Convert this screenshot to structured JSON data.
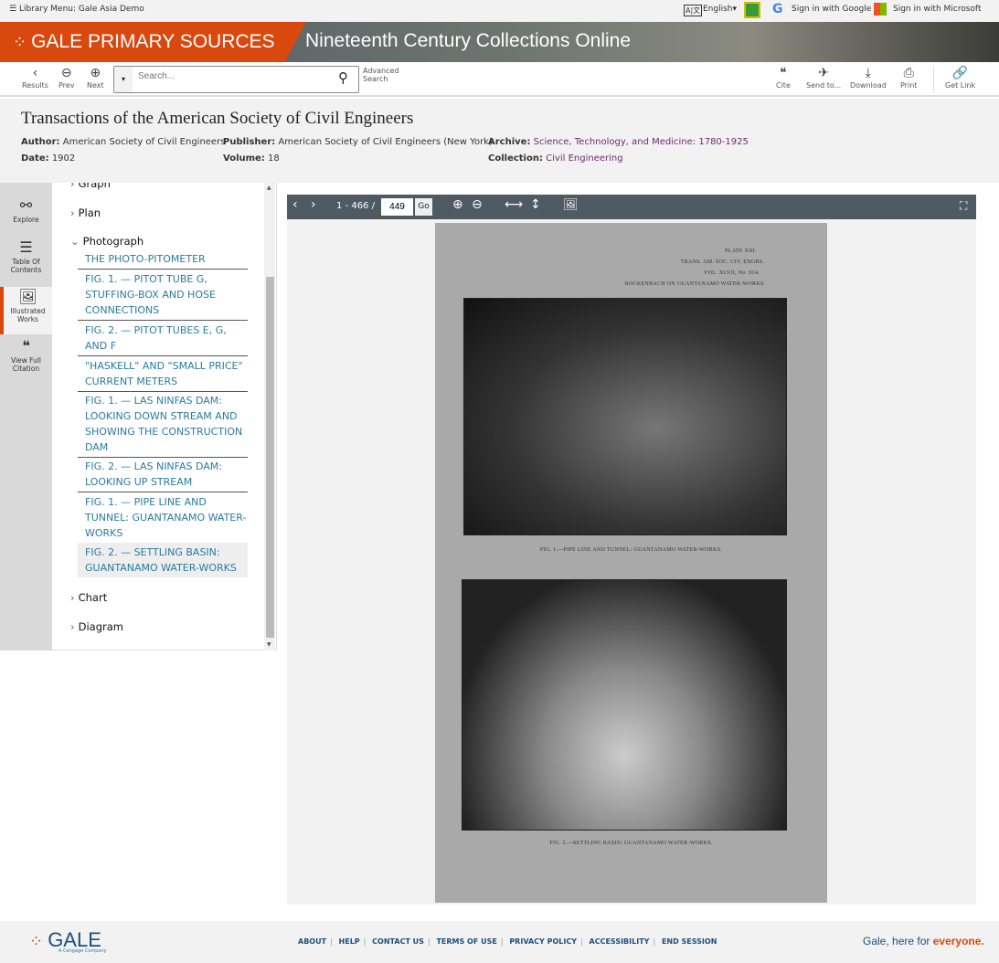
{
  "topbar": {
    "library_menu": "Library Menu: Gale Asia Demo",
    "language": "English",
    "google": "Sign in with Google",
    "microsoft": "Sign in with Microsoft"
  },
  "banner": {
    "brand": "GALE PRIMARY SOURCES",
    "collection": "Nineteenth Century Collections Online"
  },
  "toolbar": {
    "results": "Results",
    "prev": "Prev",
    "next": "Next",
    "search_placeholder": "Search...",
    "advanced": "Advanced Search",
    "cite": "Cite",
    "send": "Send to...",
    "download": "Download",
    "print": "Print",
    "get_link": "Get Link"
  },
  "meta": {
    "title": "Transactions of the American Society of Civil Engineers",
    "author_label": "Author:",
    "author": "American Society of Civil Engineers",
    "publisher_label": "Publisher:",
    "publisher": "American Society of Civil Engineers (New York)",
    "archive_label": "Archive:",
    "archive": "Science, Technology, and Medicine: 1780-1925",
    "date_label": "Date:",
    "date": "1902",
    "volume_label": "Volume:",
    "volume": "18",
    "collection_label": "Collection:",
    "collection": "Civil Engineering"
  },
  "rail": {
    "explore": "Explore",
    "toc": "Table Of Contents",
    "illustrated": "Illustrated Works",
    "citation": "View Full Citation"
  },
  "toc": {
    "graph": "Graph",
    "plan": "Plan",
    "photograph": "Photograph",
    "chart": "Chart",
    "diagram": "Diagram",
    "items": [
      "THE PHOTO-PITOMETER",
      "FIG. 1. — PITOT TUBE G, STUFFING-BOX AND HOSE CONNECTIONS",
      "FIG. 2. — PITOT TUBES E, G, AND F",
      "\"HASKELL\" AND \"SMALL PRICE\" CURRENT METERS",
      "FIG. 1. — LAS NINFAS DAM: LOOKING DOWN STREAM AND SHOWING THE CONSTRUCTION DAM",
      "FIG. 2. — LAS NINFAS DAM: LOOKING UP STREAM",
      "FIG. 1. — PIPE LINE AND TUNNEL: GUANTANAMO WATER-WORKS",
      "FIG. 2. — SETTLING BASIN: GUANTANAMO WATER-WORKS"
    ]
  },
  "viewer": {
    "range": "1 - 466 /",
    "page": "449",
    "go": "Go"
  },
  "scan": {
    "h1": "PLATE XIII.",
    "h2": "TRANS. AM. SOC. CIV. ENGRS.",
    "h3": "VOL. XLVII, No. 914.",
    "h4": "ROCKENBACH ON GUANTANAMO WATER-WORKS.",
    "cap1": "FIG. 1.—PIPE LINE AND TUNNEL: GUANTANAMO WATER-WORKS.",
    "cap2": "FIG. 2.—SETTLING BASIN: GUANTANAMO WATER-WORKS."
  },
  "footer": {
    "logo": "GALE",
    "tagline": "A Cengage Company",
    "links": [
      "ABOUT",
      "HELP",
      "CONTACT US",
      "TERMS OF USE",
      "PRIVACY POLICY",
      "ACCESSIBILITY",
      "END SESSION"
    ],
    "slogan_a": "Gale, here for ",
    "slogan_b": "everyone."
  },
  "colors": {
    "brand": "#d9480f",
    "link": "#2a7ba0",
    "archive": "#6b2d6b",
    "viewer_bar": "#4f5a63"
  }
}
